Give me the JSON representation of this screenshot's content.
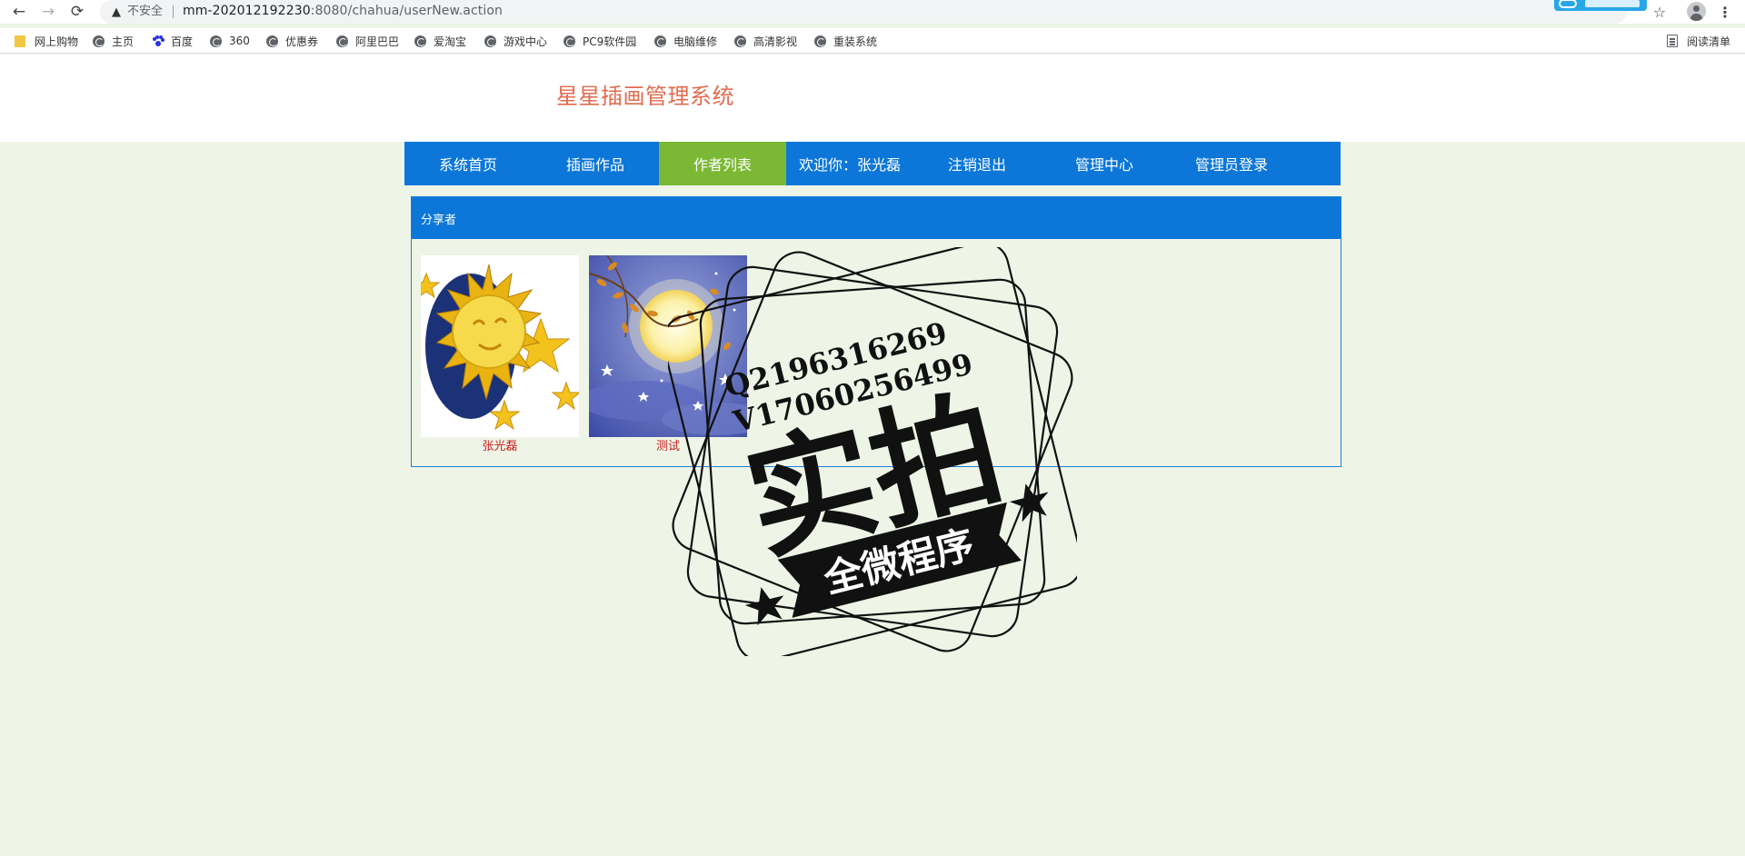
{
  "browser": {
    "back_icon": "back-arrow-icon",
    "forward_icon": "forward-arrow-icon",
    "reload_icon": "reload-icon",
    "security_label": "不安全",
    "url_host": "mm-202012192230",
    "url_rest": ":8080/chahua/userNew.action",
    "bookmark_star_icon": "star-icon",
    "profile_icon": "profile-icon",
    "menu_icon": "kebab-menu-icon"
  },
  "bookmarks": {
    "items": [
      {
        "label": "网上购物",
        "icon": "folder-icon"
      },
      {
        "label": "主页",
        "icon": "globe-icon"
      },
      {
        "label": "百度",
        "icon": "baidu-paw-icon"
      },
      {
        "label": "360",
        "icon": "globe-icon"
      },
      {
        "label": "优惠券",
        "icon": "globe-icon"
      },
      {
        "label": "阿里巴巴",
        "icon": "globe-icon"
      },
      {
        "label": "爱淘宝",
        "icon": "globe-icon"
      },
      {
        "label": "游戏中心",
        "icon": "globe-icon"
      },
      {
        "label": "PC9软件园",
        "icon": "globe-icon"
      },
      {
        "label": "电脑维修",
        "icon": "globe-icon"
      },
      {
        "label": "高清影视",
        "icon": "globe-icon"
      },
      {
        "label": "重装系统",
        "icon": "globe-icon"
      }
    ],
    "reading_list": "阅读清单"
  },
  "site": {
    "title": "星星插画管理系统",
    "title_color": "#e26b4f"
  },
  "nav": {
    "items": [
      {
        "label": "系统首页",
        "active": false
      },
      {
        "label": "插画作品",
        "active": false
      },
      {
        "label": "作者列表",
        "active": true
      },
      {
        "label": "欢迎你：张光磊",
        "active": false
      },
      {
        "label": "注销退出",
        "active": false
      },
      {
        "label": "管理中心",
        "active": false
      },
      {
        "label": "管理员登录",
        "active": false
      }
    ],
    "bg_color": "#0c77d8",
    "active_color": "#7bb935"
  },
  "panel": {
    "heading": "分享者",
    "cards": [
      {
        "caption": "张光磊",
        "image": "sun-with-stars-illustration"
      },
      {
        "caption": "测试",
        "image": "full-moon-night-illustration"
      }
    ]
  },
  "watermark": {
    "line1": "Q2196316269",
    "line2": "V17060256499",
    "big_text": "实拍",
    "ribbon_text": "全微程序"
  }
}
